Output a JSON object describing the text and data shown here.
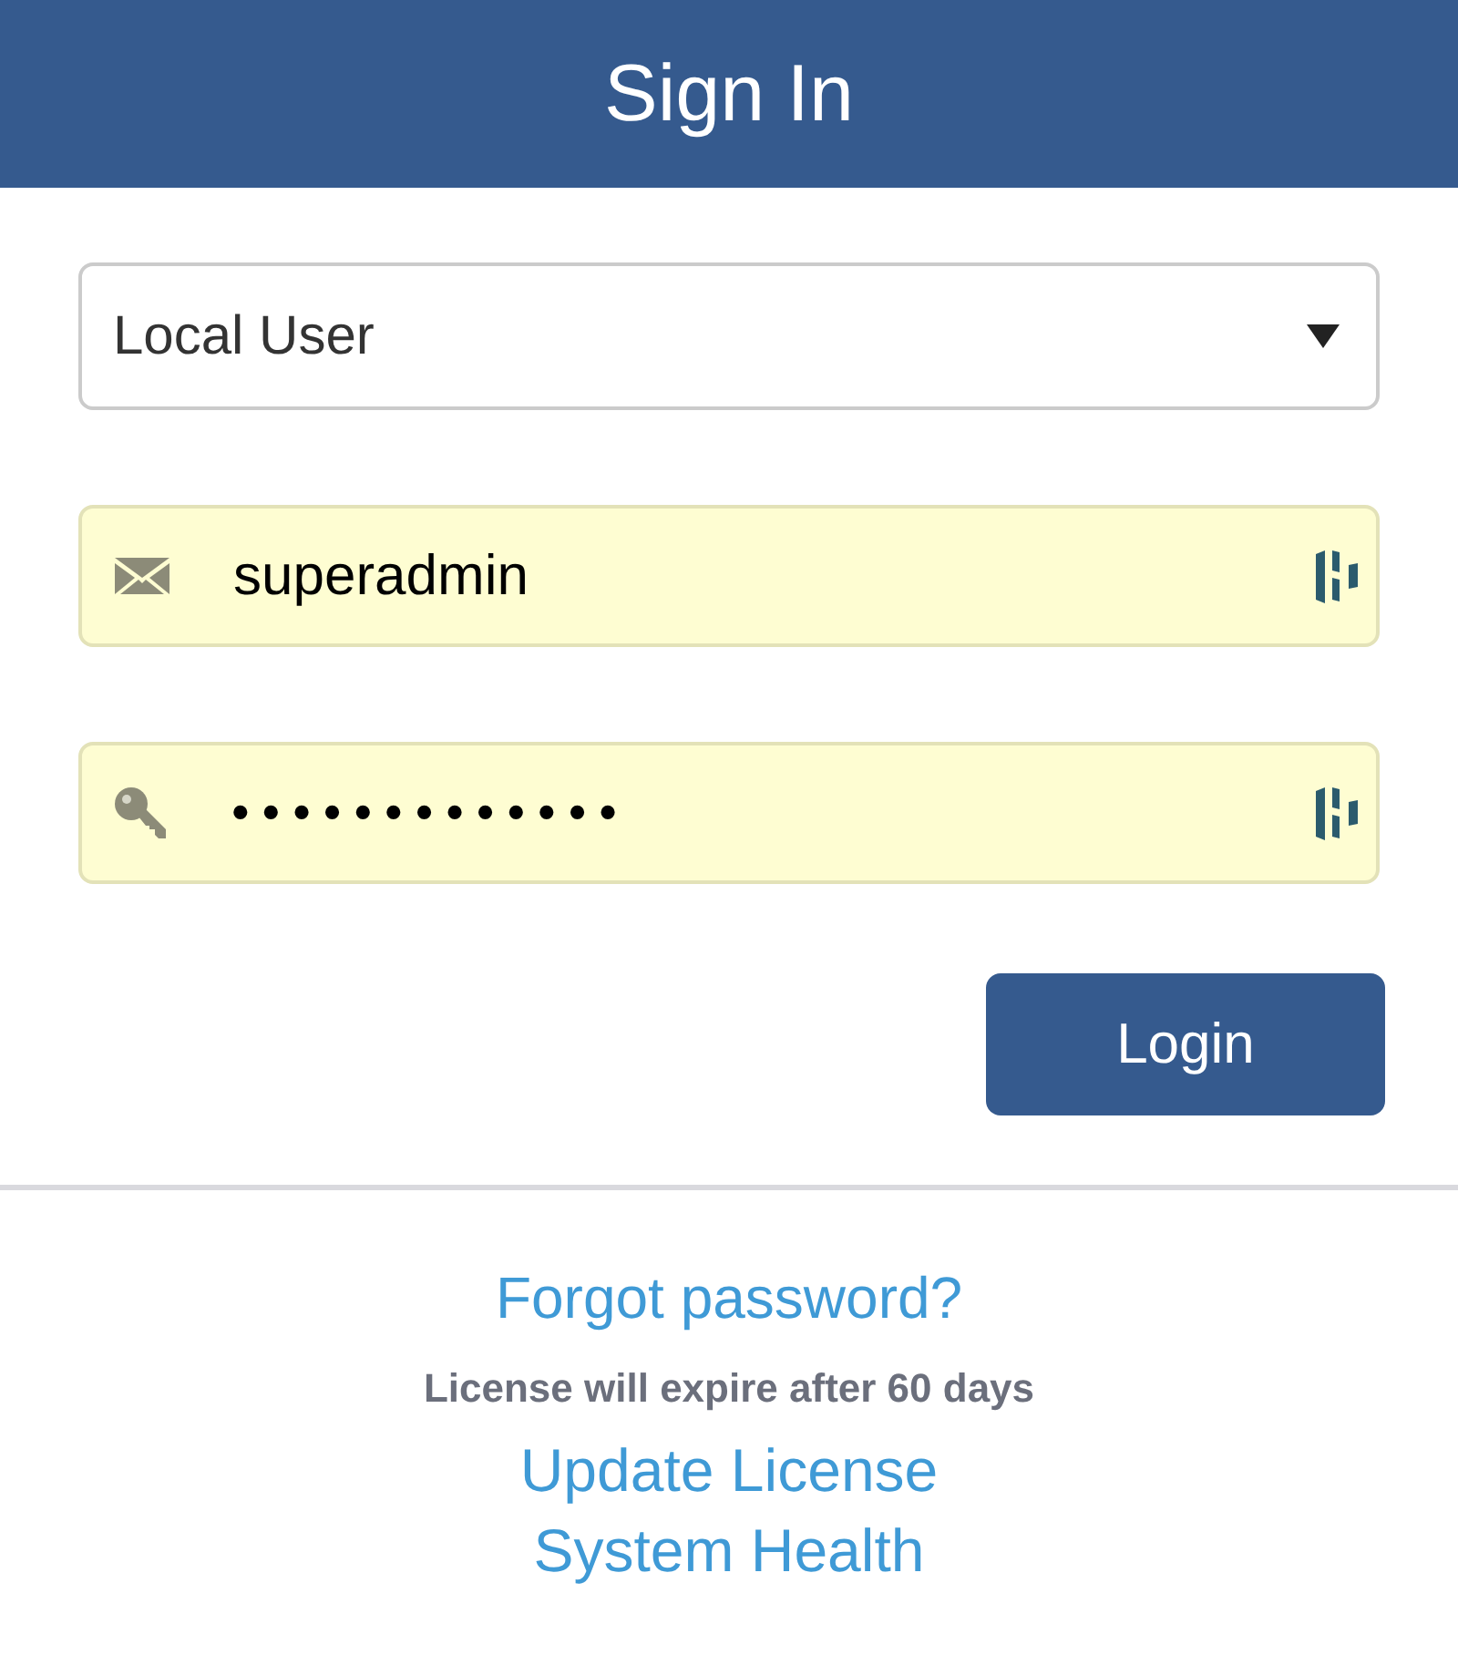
{
  "header": {
    "title": "Sign In"
  },
  "form": {
    "account_type": {
      "value": "Local User"
    },
    "username": {
      "value": "superadmin"
    },
    "password": {
      "value": "•••••••••••••"
    },
    "login_button": "Login"
  },
  "footer": {
    "forgot_link": "Forgot password?",
    "license_notice": "License will expire after 60 days",
    "links": [
      "Update License",
      "System Health"
    ]
  }
}
